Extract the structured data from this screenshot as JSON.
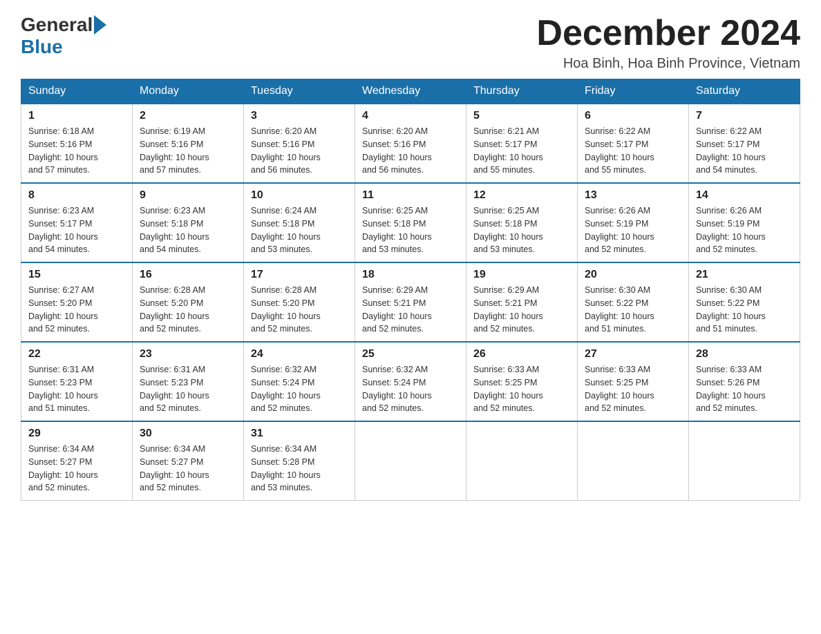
{
  "header": {
    "logo_general": "General",
    "logo_blue": "Blue",
    "month_title": "December 2024",
    "location": "Hoa Binh, Hoa Binh Province, Vietnam"
  },
  "days_of_week": [
    "Sunday",
    "Monday",
    "Tuesday",
    "Wednesday",
    "Thursday",
    "Friday",
    "Saturday"
  ],
  "weeks": [
    [
      {
        "day": "1",
        "sunrise": "6:18 AM",
        "sunset": "5:16 PM",
        "daylight": "10 hours and 57 minutes."
      },
      {
        "day": "2",
        "sunrise": "6:19 AM",
        "sunset": "5:16 PM",
        "daylight": "10 hours and 57 minutes."
      },
      {
        "day": "3",
        "sunrise": "6:20 AM",
        "sunset": "5:16 PM",
        "daylight": "10 hours and 56 minutes."
      },
      {
        "day": "4",
        "sunrise": "6:20 AM",
        "sunset": "5:16 PM",
        "daylight": "10 hours and 56 minutes."
      },
      {
        "day": "5",
        "sunrise": "6:21 AM",
        "sunset": "5:17 PM",
        "daylight": "10 hours and 55 minutes."
      },
      {
        "day": "6",
        "sunrise": "6:22 AM",
        "sunset": "5:17 PM",
        "daylight": "10 hours and 55 minutes."
      },
      {
        "day": "7",
        "sunrise": "6:22 AM",
        "sunset": "5:17 PM",
        "daylight": "10 hours and 54 minutes."
      }
    ],
    [
      {
        "day": "8",
        "sunrise": "6:23 AM",
        "sunset": "5:17 PM",
        "daylight": "10 hours and 54 minutes."
      },
      {
        "day": "9",
        "sunrise": "6:23 AM",
        "sunset": "5:18 PM",
        "daylight": "10 hours and 54 minutes."
      },
      {
        "day": "10",
        "sunrise": "6:24 AM",
        "sunset": "5:18 PM",
        "daylight": "10 hours and 53 minutes."
      },
      {
        "day": "11",
        "sunrise": "6:25 AM",
        "sunset": "5:18 PM",
        "daylight": "10 hours and 53 minutes."
      },
      {
        "day": "12",
        "sunrise": "6:25 AM",
        "sunset": "5:18 PM",
        "daylight": "10 hours and 53 minutes."
      },
      {
        "day": "13",
        "sunrise": "6:26 AM",
        "sunset": "5:19 PM",
        "daylight": "10 hours and 52 minutes."
      },
      {
        "day": "14",
        "sunrise": "6:26 AM",
        "sunset": "5:19 PM",
        "daylight": "10 hours and 52 minutes."
      }
    ],
    [
      {
        "day": "15",
        "sunrise": "6:27 AM",
        "sunset": "5:20 PM",
        "daylight": "10 hours and 52 minutes."
      },
      {
        "day": "16",
        "sunrise": "6:28 AM",
        "sunset": "5:20 PM",
        "daylight": "10 hours and 52 minutes."
      },
      {
        "day": "17",
        "sunrise": "6:28 AM",
        "sunset": "5:20 PM",
        "daylight": "10 hours and 52 minutes."
      },
      {
        "day": "18",
        "sunrise": "6:29 AM",
        "sunset": "5:21 PM",
        "daylight": "10 hours and 52 minutes."
      },
      {
        "day": "19",
        "sunrise": "6:29 AM",
        "sunset": "5:21 PM",
        "daylight": "10 hours and 52 minutes."
      },
      {
        "day": "20",
        "sunrise": "6:30 AM",
        "sunset": "5:22 PM",
        "daylight": "10 hours and 51 minutes."
      },
      {
        "day": "21",
        "sunrise": "6:30 AM",
        "sunset": "5:22 PM",
        "daylight": "10 hours and 51 minutes."
      }
    ],
    [
      {
        "day": "22",
        "sunrise": "6:31 AM",
        "sunset": "5:23 PM",
        "daylight": "10 hours and 51 minutes."
      },
      {
        "day": "23",
        "sunrise": "6:31 AM",
        "sunset": "5:23 PM",
        "daylight": "10 hours and 52 minutes."
      },
      {
        "day": "24",
        "sunrise": "6:32 AM",
        "sunset": "5:24 PM",
        "daylight": "10 hours and 52 minutes."
      },
      {
        "day": "25",
        "sunrise": "6:32 AM",
        "sunset": "5:24 PM",
        "daylight": "10 hours and 52 minutes."
      },
      {
        "day": "26",
        "sunrise": "6:33 AM",
        "sunset": "5:25 PM",
        "daylight": "10 hours and 52 minutes."
      },
      {
        "day": "27",
        "sunrise": "6:33 AM",
        "sunset": "5:25 PM",
        "daylight": "10 hours and 52 minutes."
      },
      {
        "day": "28",
        "sunrise": "6:33 AM",
        "sunset": "5:26 PM",
        "daylight": "10 hours and 52 minutes."
      }
    ],
    [
      {
        "day": "29",
        "sunrise": "6:34 AM",
        "sunset": "5:27 PM",
        "daylight": "10 hours and 52 minutes."
      },
      {
        "day": "30",
        "sunrise": "6:34 AM",
        "sunset": "5:27 PM",
        "daylight": "10 hours and 52 minutes."
      },
      {
        "day": "31",
        "sunrise": "6:34 AM",
        "sunset": "5:28 PM",
        "daylight": "10 hours and 53 minutes."
      },
      null,
      null,
      null,
      null
    ]
  ],
  "labels": {
    "sunrise": "Sunrise:",
    "sunset": "Sunset:",
    "daylight": "Daylight:"
  }
}
